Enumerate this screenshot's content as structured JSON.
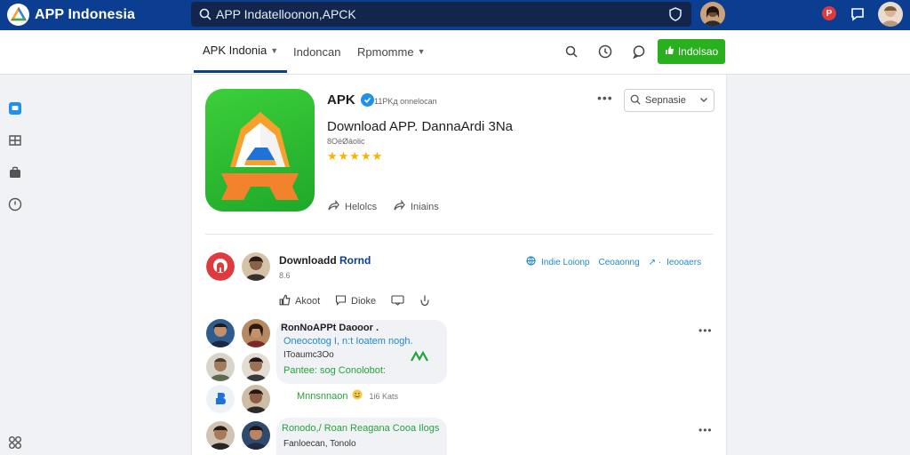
{
  "brand": {
    "name": "APP Indonesia"
  },
  "search": {
    "value": "APP Indatelloonon,APCK"
  },
  "topbar": {
    "notif_count": "P"
  },
  "nav": {
    "tabs": [
      {
        "label": "APK Indonia"
      },
      {
        "label": "Indoncan"
      },
      {
        "label": "Rpmomme"
      }
    ],
    "cta_label": "Indolsao"
  },
  "app": {
    "name": "APK",
    "meta": "11PKд onnelocan",
    "title": "Download APP. DannaArdi 3Na",
    "subtitle": "8OéØàolic",
    "stars": "★★★★★",
    "actions": [
      "Helolcs",
      "Iniains"
    ],
    "version_select": "Sepnasie"
  },
  "post": {
    "title_prefix": "Downloadd ",
    "title_highlight": "Rornd",
    "meta": "8.6",
    "links": [
      "Indie Loionp",
      "Ceoaonng",
      "↗ ·",
      "Ieooaers"
    ],
    "actions": [
      "Akoot",
      "Dioke"
    ]
  },
  "comments": [
    {
      "author": "RonNoAPPt Daooor .",
      "lines": [
        {
          "text": "Oneocotog I, n:t Ioatem nogh.",
          "color": "blue"
        },
        {
          "text": "IToaumc3Oo",
          "color": "dark"
        },
        {
          "text": "Pantee: sog Conolobot:",
          "color": "green"
        }
      ],
      "reaction": "Mnnsnnaon",
      "reaction_count": "1i6 Kats"
    },
    {
      "author": "",
      "lines": [
        {
          "text": "Ronodo,/ Roan  Reagana Cooa Ilogs",
          "color": "green"
        },
        {
          "text": "Fanloecan, Tonolo",
          "color": "dark"
        }
      ]
    }
  ],
  "colors": {
    "topbar": "#0b3d91",
    "accent_green": "#28b01f",
    "link": "#1f8acb"
  }
}
